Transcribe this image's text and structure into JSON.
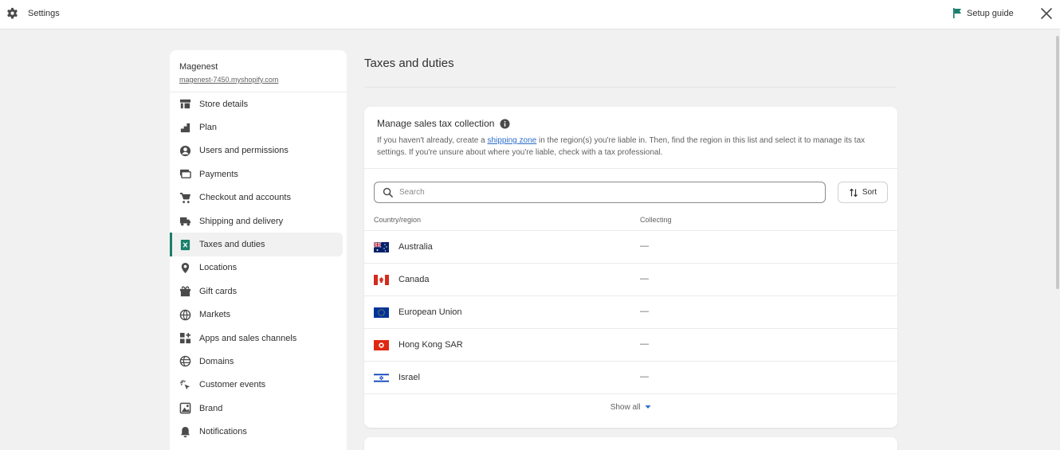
{
  "topbar": {
    "title": "Settings",
    "setup_guide": "Setup guide"
  },
  "sidebar": {
    "store_name": "Magenest",
    "store_domain": "magenest-7450.myshopify.com",
    "items": [
      {
        "label": "Store details",
        "icon": "store-icon"
      },
      {
        "label": "Plan",
        "icon": "plan-icon"
      },
      {
        "label": "Users and permissions",
        "icon": "user-icon"
      },
      {
        "label": "Payments",
        "icon": "payments-icon"
      },
      {
        "label": "Checkout and accounts",
        "icon": "cart-icon"
      },
      {
        "label": "Shipping and delivery",
        "icon": "truck-icon"
      },
      {
        "label": "Taxes and duties",
        "icon": "tax-icon",
        "active": true
      },
      {
        "label": "Locations",
        "icon": "location-pin-icon"
      },
      {
        "label": "Gift cards",
        "icon": "gift-icon"
      },
      {
        "label": "Markets",
        "icon": "globe-icon"
      },
      {
        "label": "Apps and sales channels",
        "icon": "apps-icon"
      },
      {
        "label": "Domains",
        "icon": "domains-icon"
      },
      {
        "label": "Customer events",
        "icon": "cursor-click-icon"
      },
      {
        "label": "Brand",
        "icon": "brand-icon"
      },
      {
        "label": "Notifications",
        "icon": "bell-icon"
      }
    ]
  },
  "main": {
    "page_title": "Taxes and duties",
    "card": {
      "heading": "Manage sales tax collection",
      "desc_before": "If you haven't already, create a ",
      "desc_link": "shipping zone",
      "desc_after": " in the region(s) you're liable in. Then, find the region in this list and select it to manage its tax settings. If you're unsure about where you're liable, check with a tax professional.",
      "search_placeholder": "Search",
      "sort_label": "Sort",
      "columns": [
        "Country/region",
        "Collecting"
      ],
      "rows": [
        {
          "country": "Australia",
          "collecting": "—",
          "flag": "australia-flag-icon"
        },
        {
          "country": "Canada",
          "collecting": "—",
          "flag": "canada-flag-icon"
        },
        {
          "country": "European Union",
          "collecting": "—",
          "flag": "eu-flag-icon"
        },
        {
          "country": "Hong Kong SAR",
          "collecting": "—",
          "flag": "hong-kong-flag-icon"
        },
        {
          "country": "Israel",
          "collecting": "—",
          "flag": "israel-flag-icon"
        }
      ],
      "show_all": "Show all"
    }
  },
  "colors": {
    "accent": "#1a7f6b",
    "link": "#2c6ecb",
    "background": "#f1f1f1"
  }
}
